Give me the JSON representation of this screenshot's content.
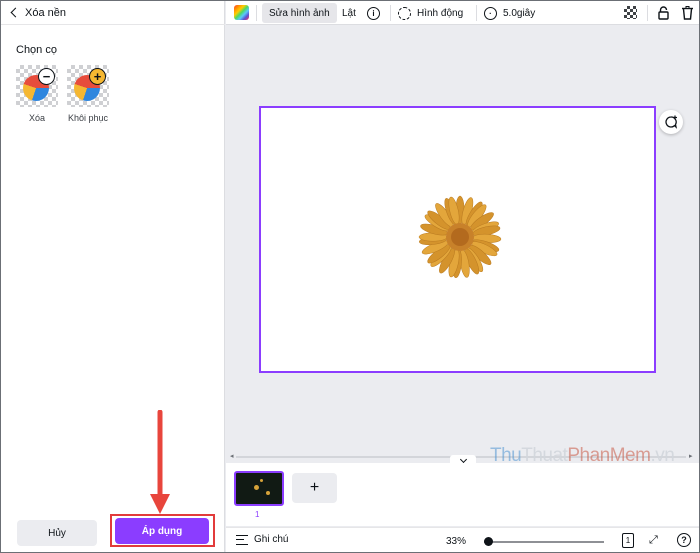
{
  "left_panel": {
    "back_label": "Xóa nền",
    "brush_title": "Chọn cọ",
    "brushes": [
      {
        "label": "Xóa",
        "icon": "minus-icon"
      },
      {
        "label": "Khôi phục",
        "icon": "plus-icon"
      }
    ],
    "cancel_label": "Hủy",
    "apply_label": "Áp dụng",
    "apply_color": "#8b3dff",
    "highlight_color": "#e23b3b"
  },
  "toolbar": {
    "edit_image_label": "Sửa hình ảnh",
    "flip_label": "Lật",
    "info_icon": "i",
    "animate_label": "Hình động",
    "duration_label": "5.0giây"
  },
  "canvas": {
    "selection_color": "#8b3dff",
    "comment_icon": "comment-add-icon"
  },
  "pages": {
    "add_label": "+",
    "current_page": "1"
  },
  "footer": {
    "notes_label": "Ghi chú",
    "zoom": "33%",
    "page_count": "1",
    "help": "?"
  },
  "watermark": {
    "part1": "Thu",
    "part2": "Thuat",
    "part3": "PhanMem",
    "part4": ".vn"
  }
}
